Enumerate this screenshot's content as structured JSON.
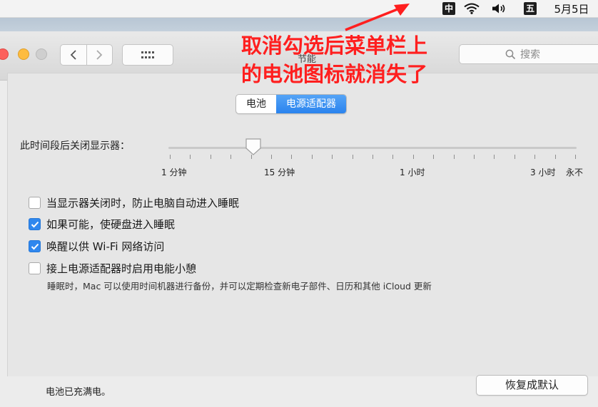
{
  "menubar": {
    "input_method": "中",
    "calendar_badge": "五",
    "date": "5月5日",
    "icons": [
      "input-method-icon",
      "wifi-icon",
      "volume-icon",
      "calendar-icon"
    ]
  },
  "window": {
    "title": "节能",
    "search_placeholder": "搜索",
    "icons": [
      "back-icon",
      "forward-icon",
      "grid-icon",
      "search-icon"
    ]
  },
  "tabs": [
    {
      "label": "电池",
      "selected": false
    },
    {
      "label": "电源适配器",
      "selected": true
    }
  ],
  "display_sleep": {
    "label": "此时间段后关闭显示器：",
    "value_label": "15 分钟",
    "tick_labels": [
      "1 分钟",
      "15 分钟",
      "1 小时",
      "3 小时",
      "永不"
    ]
  },
  "options": [
    {
      "label": "当显示器关闭时，防止电脑自动进入睡眠",
      "checked": false
    },
    {
      "label": "如果可能，使硬盘进入睡眠",
      "checked": true
    },
    {
      "label": "唤醒以供 Wi-Fi 网络访问",
      "checked": true
    },
    {
      "label": "接上电源适配器时启用电能小憩",
      "checked": false
    }
  ],
  "note": "睡眠时，Mac 可以使用时间机器进行备份，并可以定期检查新电子部件、日历和其他 iCloud 更新",
  "footer": {
    "status": "电池已充满电。",
    "restore_button": "恢复成默认"
  },
  "annotation": {
    "line1": "取消勾选后菜单栏上",
    "line2": "的电池图标就消失了",
    "color": "#ff1f1f"
  },
  "colors": {
    "accent": "#2f87ee",
    "traffic_red": "#fc605c",
    "traffic_yellow": "#fdbc40"
  }
}
